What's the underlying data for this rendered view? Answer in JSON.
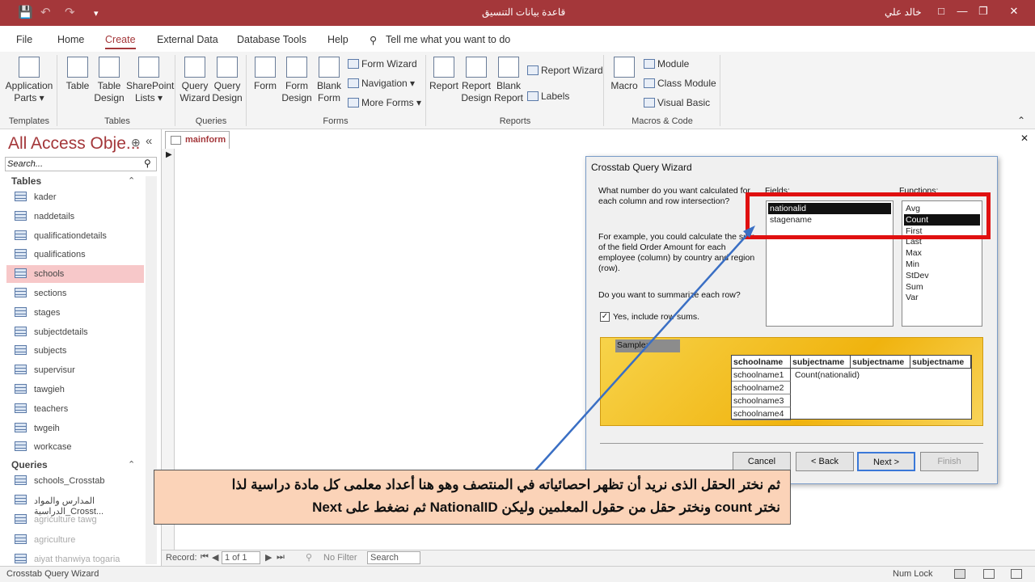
{
  "window": {
    "title": "قاعدة بيانات التنسيق",
    "user": "خالد علي"
  },
  "menu": {
    "file": "File",
    "home": "Home",
    "create": "Create",
    "external": "External Data",
    "dbtools": "Database Tools",
    "help": "Help",
    "tellme": "Tell me what you want to do"
  },
  "ribbon": {
    "templates": {
      "app_parts_1": "Application",
      "app_parts_2": "Parts",
      "group": "Templates"
    },
    "tables": {
      "table": "Table",
      "design_1": "Table",
      "design_2": "Design",
      "sp_1": "SharePoint",
      "sp_2": "Lists",
      "group": "Tables"
    },
    "queries": {
      "wiz_1": "Query",
      "wiz_2": "Wizard",
      "des_1": "Query",
      "des_2": "Design",
      "group": "Queries"
    },
    "forms": {
      "form": "Form",
      "fd_1": "Form",
      "fd_2": "Design",
      "bf_1": "Blank",
      "bf_2": "Form",
      "wizard": "Form Wizard",
      "navigation": "Navigation",
      "more": "More Forms",
      "group": "Forms"
    },
    "reports": {
      "report": "Report",
      "rd_1": "Report",
      "rd_2": "Design",
      "br_1": "Blank",
      "br_2": "Report",
      "wizard": "Report Wizard",
      "labels": "Labels",
      "group": "Reports"
    },
    "macros": {
      "macro": "Macro",
      "module": "Module",
      "class_module": "Class Module",
      "vb": "Visual Basic",
      "group": "Macros & Code"
    }
  },
  "nav": {
    "title": "All Access Obje...",
    "search_placeholder": "Search...",
    "tables_header": "Tables",
    "tables": [
      "kader",
      "naddetails",
      "qualificationdetails",
      "qualifications",
      "schools",
      "sections",
      "stages",
      "subjectdetails",
      "subjects",
      "supervisur",
      "tawgieh",
      "teachers",
      "twgeih",
      "workcase"
    ],
    "queries_header": "Queries",
    "queries": [
      "schools_Crosstab",
      "المدارس والمواد الدراسية_Crosst...",
      "agriculture tawg",
      "agriculture",
      "aiyat thanwiya togaria"
    ]
  },
  "doc": {
    "tab": "mainform"
  },
  "record_bar": {
    "label": "Record:",
    "pos": "1 of 1",
    "filter": "No Filter",
    "search": "Search"
  },
  "status": {
    "left": "Crosstab Query Wizard",
    "numlock": "Num Lock"
  },
  "wizard": {
    "title": "Crosstab Query Wizard",
    "q1": "What number do you want calculated for",
    "q2": "each column and row intersection?",
    "ex1": "For example, you could calculate the sum",
    "ex2": "of the field Order Amount for each",
    "ex3": "employee (column)  by country and region",
    "ex4": "(row).",
    "summ": "Do you want to summarize each row?",
    "checkbox": "Yes, include row sums.",
    "fields_label": "Fields:",
    "fields": [
      "nationalid",
      "stagename"
    ],
    "functions_label": "Functions:",
    "functions": [
      "Avg",
      "Count",
      "First",
      "Last",
      "Max",
      "Min",
      "StDev",
      "Sum",
      "Var"
    ],
    "sample_label": "Sample:",
    "grid_headers": [
      "schoolname",
      "subjectname",
      "subjectname",
      "subjectname"
    ],
    "grid_rows": [
      "schoolname1",
      "schoolname2",
      "schoolname3",
      "schoolname4"
    ],
    "grid_cell": "Count(nationalid)",
    "buttons": {
      "cancel": "Cancel",
      "back": "< Back",
      "next": "Next >",
      "finish": "Finish"
    }
  },
  "callout": {
    "line1": "ثم نختر الحقل الذى نريد أن تظهر احصائياته في المنتصف وهو  هنا أعداد معلمى كل مادة دراسية لذا",
    "line2": "نختر count ونختر حقل من حقول المعلمين وليكن NationalID ثم نضغط على Next"
  },
  "colors": {
    "accent": "#a4373a",
    "highlight": "#e01010",
    "callout_bg": "#fbd3b8",
    "arrow": "#3a6fc4"
  }
}
